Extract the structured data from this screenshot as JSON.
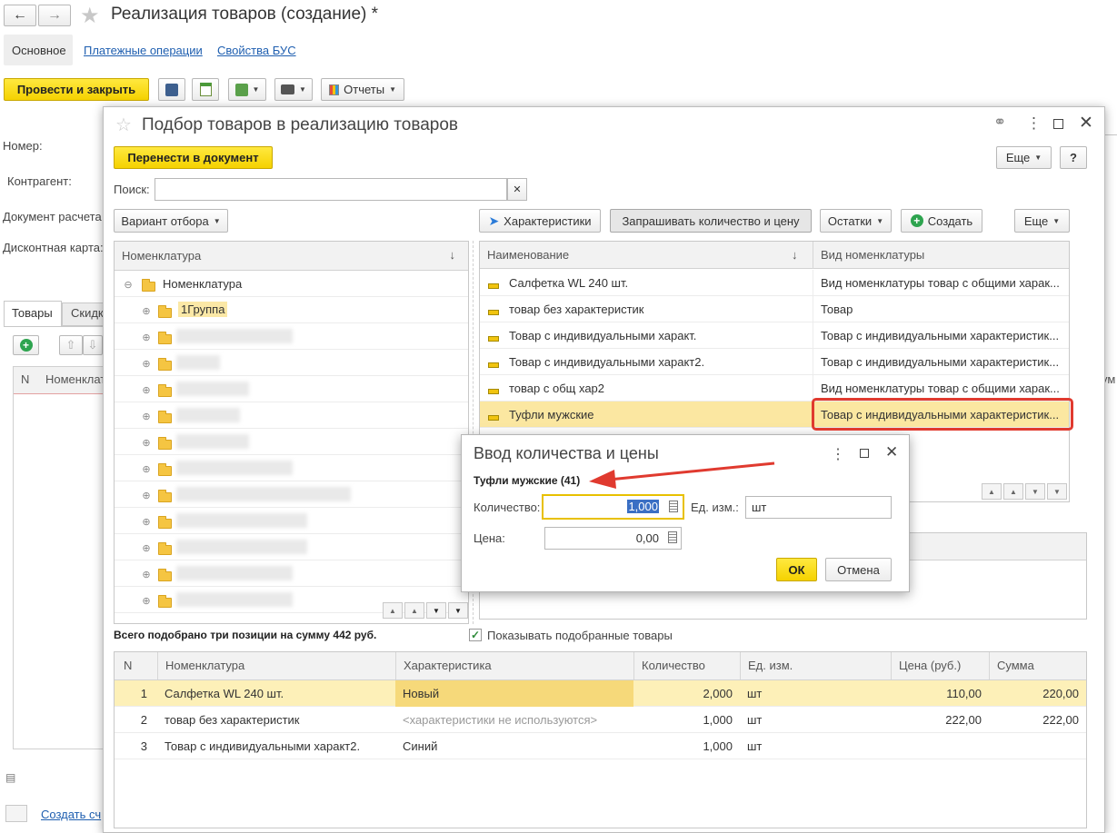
{
  "doc": {
    "title": "Реализация товаров (создание) *",
    "tabs": [
      "Основное",
      "Платежные операции",
      "Свойства БУС"
    ],
    "post_close": "Провести и закрыть",
    "reports": "Отчеты",
    "labels": [
      "Номер:",
      "Контрагент:",
      "Документ расчета",
      "Дисконтная карта:"
    ],
    "sub_tabs": [
      "Товары",
      "Скидк"
    ],
    "col_n": "N",
    "col_nom": "Номенклата",
    "col_right": "ум",
    "create_link": "Создать сч"
  },
  "picker": {
    "title": "Подбор товаров в реализацию товаров",
    "transfer": "Перенести в документ",
    "more": "Еще",
    "help": "?",
    "search_label": "Поиск:",
    "search_value": "",
    "variant": "Вариант отбора",
    "btn_characteristics": "Характеристики",
    "btn_ask": "Запрашивать количество и цену",
    "btn_stock": "Остатки",
    "btn_create": "Создать",
    "more2": "Еще",
    "tree_header": "Номенклатура",
    "tree_root": "Номенклатура",
    "tree_group": "1Группа",
    "list_headers": [
      "Наименование",
      "Вид номенклатуры"
    ],
    "items": [
      {
        "name": "Салфетка WL 240 шт.",
        "kind": "Вид номенклатуры товар с общими харак..."
      },
      {
        "name": "товар без характеристик",
        "kind": "Товар"
      },
      {
        "name": "Товар с индивидуальными характ.",
        "kind": "Товар с индивидуальными характеристик..."
      },
      {
        "name": "Товар с индивидуальными характ2.",
        "kind": "Товар с индивидуальными характеристик..."
      },
      {
        "name": "товар с общ хар2",
        "kind": "Вид номенклатуры товар с общими харак..."
      },
      {
        "name": "Туфли мужские",
        "kind": "Товар с индивидуальными характеристик..."
      }
    ],
    "summary": "Всего подобрано три позиции на сумму 442 руб.",
    "show_selected": "Показывать подобранные товары",
    "sel_headers": [
      "N",
      "Номенклатура",
      "Характеристика",
      "Количество",
      "Ед. изм.",
      "Цена (руб.)",
      "Сумма"
    ],
    "selected": [
      {
        "n": "1",
        "name": "Салфетка WL 240 шт.",
        "ch": "Новый",
        "qty": "2,000",
        "unit": "шт",
        "price": "110,00",
        "sum": "220,00"
      },
      {
        "n": "2",
        "name": "товар без характеристик",
        "ch": "<характеристики не используются>",
        "qty": "1,000",
        "unit": "шт",
        "price": "222,00",
        "sum": "222,00"
      },
      {
        "n": "3",
        "name": "Товар с индивидуальными характ2.",
        "ch": "Синий",
        "qty": "1,000",
        "unit": "шт",
        "price": "",
        "sum": ""
      }
    ]
  },
  "qty_dialog": {
    "title": "Ввод количества и цены",
    "item": "Туфли мужские (41)",
    "qty_label": "Количество:",
    "qty_value": "1,000",
    "unit_label": "Ед. изм.:",
    "unit_value": "шт",
    "price_label": "Цена:",
    "price_value": "0,00",
    "ok": "ОК",
    "cancel": "Отмена"
  },
  "colors": {
    "accent_yellow": "#f5d200",
    "highlight": "#fdf0b0",
    "red_annotation": "#e03a2f",
    "link": "#1f5fb0"
  }
}
